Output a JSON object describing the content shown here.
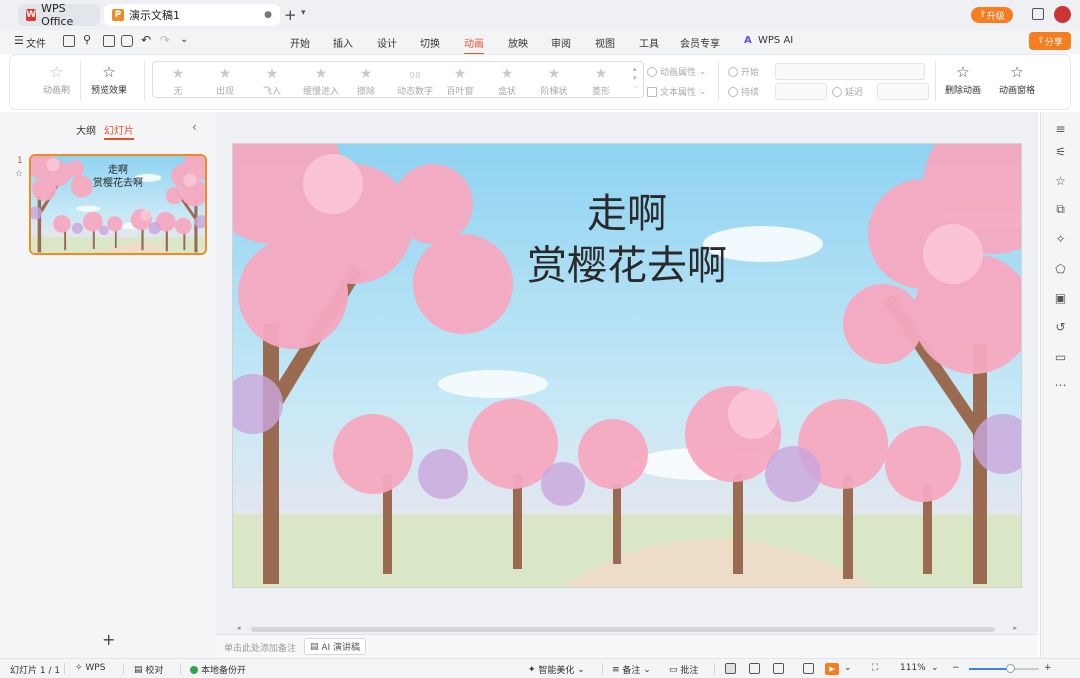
{
  "titlebar": {
    "tabs": [
      {
        "label": "WPS Office",
        "icon": "wps-logo-icon"
      },
      {
        "label": "演示文稿1",
        "icon": "presentation-logo-icon"
      }
    ],
    "new_tab_symbol": "+",
    "dropdown_symbol": "⌄",
    "upgrade_label": "升级",
    "modified_dot": "●"
  },
  "menubar": {
    "file_label": "文件",
    "tabs": [
      "开始",
      "插入",
      "设计",
      "切换",
      "动画",
      "放映",
      "审阅",
      "视图",
      "工具",
      "会员专享",
      "WPS AI"
    ],
    "active_tab": "动画",
    "share_label": "分享"
  },
  "ribbon": {
    "animation_painter": "动画刷",
    "preview": "预览效果",
    "effects": [
      "无",
      "出现",
      "飞入",
      "缓慢进入",
      "擦除",
      "动态数字",
      "百叶窗",
      "盒状",
      "阶梯状",
      "菱形"
    ],
    "animation_props": "动画属性",
    "text_props": "文本属性",
    "start_label": "开始",
    "duration_label": "持续",
    "delay_label": "延迟",
    "delete_animation": "删除动画",
    "animation_pane": "动画窗格"
  },
  "left_panel": {
    "tabs": [
      "大纲",
      "幻灯片"
    ],
    "active_tab": "幻灯片",
    "slide_number": "1",
    "add_symbol": "+"
  },
  "slide": {
    "title_line1": "走啊",
    "title_line2": "赏樱花去啊"
  },
  "notes": {
    "placeholder": "单击此处添加备注",
    "ai_button": "AI 演讲稿"
  },
  "statusbar": {
    "slide_count": "幻灯片 1 / 1",
    "wps_label": "WPS",
    "proofread": "校对",
    "backup": "本地备份开",
    "smart_beautify": "智能美化",
    "notes": "备注",
    "comments": "批注",
    "zoom": "111%",
    "zoom_fraction": 0.58
  },
  "colors": {
    "accent": "#e4542c",
    "brand_orange": "#f57e20"
  }
}
